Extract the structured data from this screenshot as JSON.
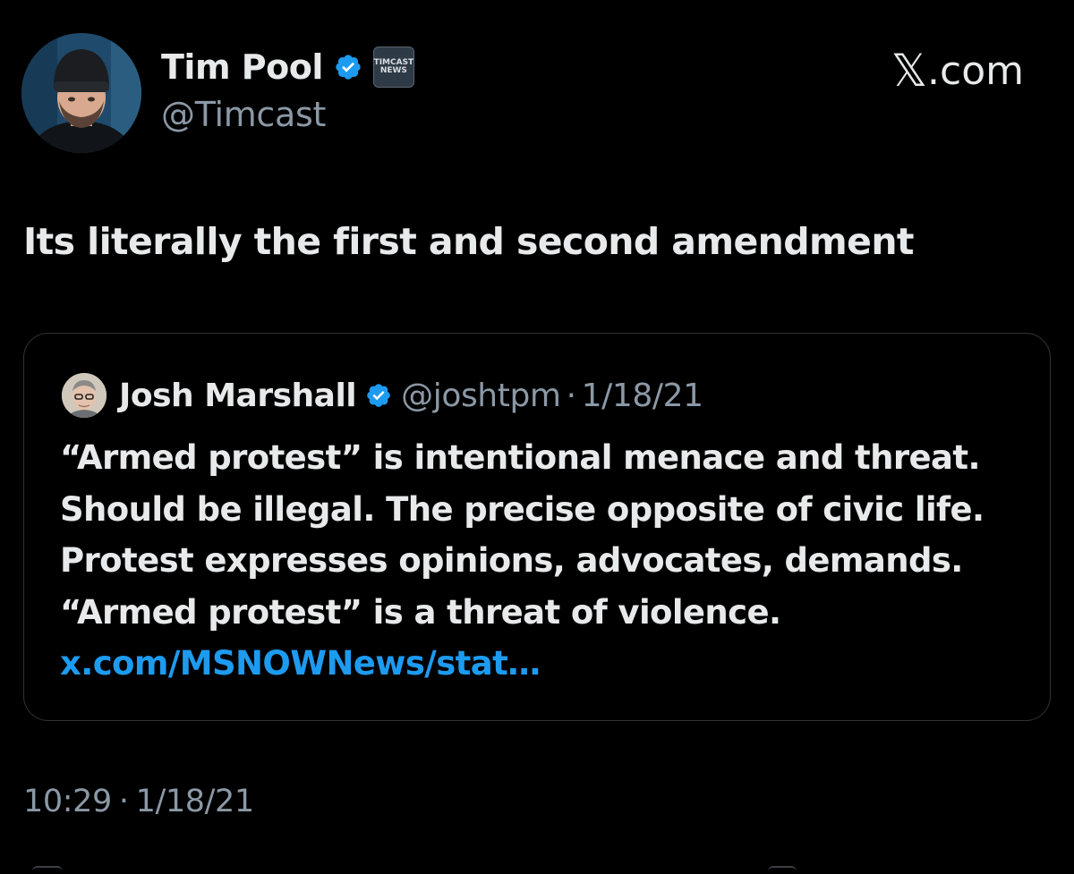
{
  "author": {
    "name": "Tim Pool",
    "handle": "@Timcast",
    "org_badge_line1": "TIMCAST",
    "org_badge_line2": "NEWS",
    "verified": true
  },
  "brand": {
    "x_glyph": "𝕏",
    "suffix": ".com"
  },
  "tweet": {
    "text": "Its literally the first and second amendment",
    "time": "10:29",
    "separator": "·",
    "date": "1/18/21"
  },
  "quoted_tweet": {
    "name": "Josh Marshall",
    "handle": "@joshtpm",
    "separator": "·",
    "date": "1/18/21",
    "verified": true,
    "text": "“Armed protest” is intentional menace and threat. Should be illegal. The precise opposite of civic life. Protest expresses opinions, advocates, demands. “Armed protest” is a threat of violence.",
    "link": "x.com/MSNOWNews/stat…"
  },
  "colors": {
    "background": "#000000",
    "text": "#e7e9ea",
    "secondary": "#8b98a5",
    "link": "#1d9bf0",
    "verified": "#1d9bf0",
    "card_border": "#2f3336"
  }
}
